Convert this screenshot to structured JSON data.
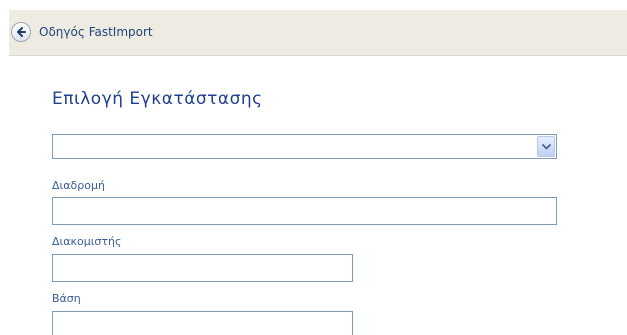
{
  "header": {
    "title": "Οδηγός FastImport",
    "back_icon": "back-arrow-icon"
  },
  "section": {
    "title": "Επιλογή Εγκατάστασης"
  },
  "installation_select": {
    "value": "",
    "arrow_icon": "chevron-down-icon"
  },
  "fields": {
    "path": {
      "label": "Διαδρομή",
      "value": ""
    },
    "server": {
      "label": "Διακομιστής",
      "value": ""
    },
    "database": {
      "label": "Βάση",
      "value": ""
    }
  }
}
